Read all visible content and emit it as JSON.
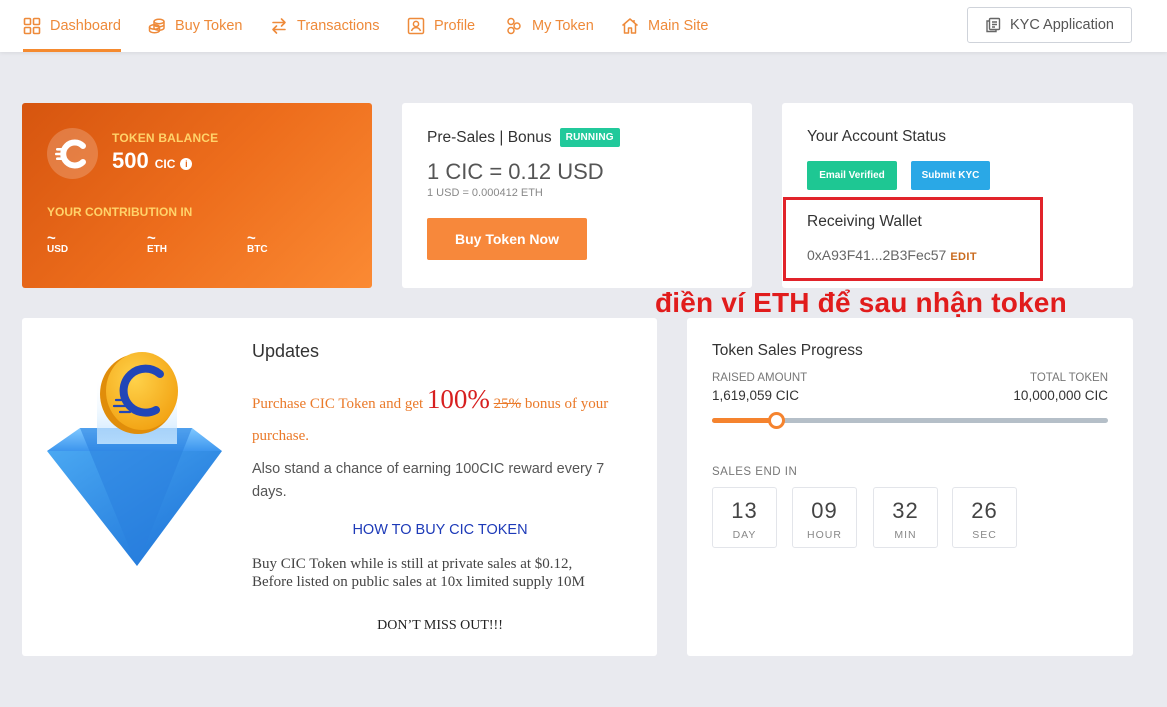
{
  "nav": {
    "items": [
      {
        "label": "Dashboard",
        "icon": "dashboard-icon",
        "active": true
      },
      {
        "label": "Buy Token",
        "icon": "coins-icon"
      },
      {
        "label": "Transactions",
        "icon": "transfer-arrows-icon"
      },
      {
        "label": "Profile",
        "icon": "profile-icon"
      },
      {
        "label": "My Token",
        "icon": "token-stack-icon"
      },
      {
        "label": "Main Site",
        "icon": "home-icon"
      }
    ],
    "kyc_button": "KYC Application"
  },
  "balance": {
    "label": "TOKEN BALANCE",
    "value": "500",
    "unit": "CIC",
    "info": "i",
    "contribution_label": "YOUR CONTRIBUTION IN",
    "currencies": [
      {
        "symbol": "~",
        "name": "USD"
      },
      {
        "symbol": "~",
        "name": "ETH"
      },
      {
        "symbol": "~",
        "name": "BTC"
      }
    ]
  },
  "presale": {
    "title": "Pre-Sales | Bonus",
    "badge": "RUNNING",
    "rate": "1 CIC = 0.12 USD",
    "rate_sub": "1 USD = 0.000412 ETH",
    "button": "Buy Token Now"
  },
  "account": {
    "title": "Your Account Status",
    "email_verified": "Email Verified",
    "submit_kyc": "Submit KYC",
    "wallet_title": "Receiving Wallet",
    "wallet_address": "0xA93F41...2B3Fec57",
    "edit": "EDIT"
  },
  "annotation": "điền ví ETH để sau nhận token",
  "updates": {
    "title": "Updates",
    "promo_pre": "Purchase CIC Token and get ",
    "promo_big": "100%",
    "promo_strike": "25%",
    "promo_post": " bonus of your purchase.",
    "chance": "Also stand a chance of earning  100CIC reward every 7 days.",
    "howto": "HOW TO BUY CIC TOKEN",
    "private_line1": "Buy CIC Token while is still at private sales at $0.12,",
    "private_line2": "Before listed on public sales at 10x limited supply 10M",
    "dont_miss": "DON’T MISS OUT!!!"
  },
  "progress": {
    "title": "Token Sales Progress",
    "raised_label": "RAISED AMOUNT",
    "raised_value": "1,619,059 CIC",
    "total_label": "TOTAL TOKEN",
    "total_value": "10,000,000 CIC",
    "fraction": 0.162,
    "sales_end_label": "SALES END IN",
    "countdown": [
      {
        "value": "13",
        "unit": "DAY"
      },
      {
        "value": "09",
        "unit": "HOUR"
      },
      {
        "value": "32",
        "unit": "MIN"
      },
      {
        "value": "26",
        "unit": "SEC"
      }
    ]
  },
  "colors": {
    "accent": "#f58a2f",
    "green": "#1ec793",
    "blue": "#2aa8e6",
    "annotation_red": "#e11c1c",
    "background": "#e9eaef"
  }
}
